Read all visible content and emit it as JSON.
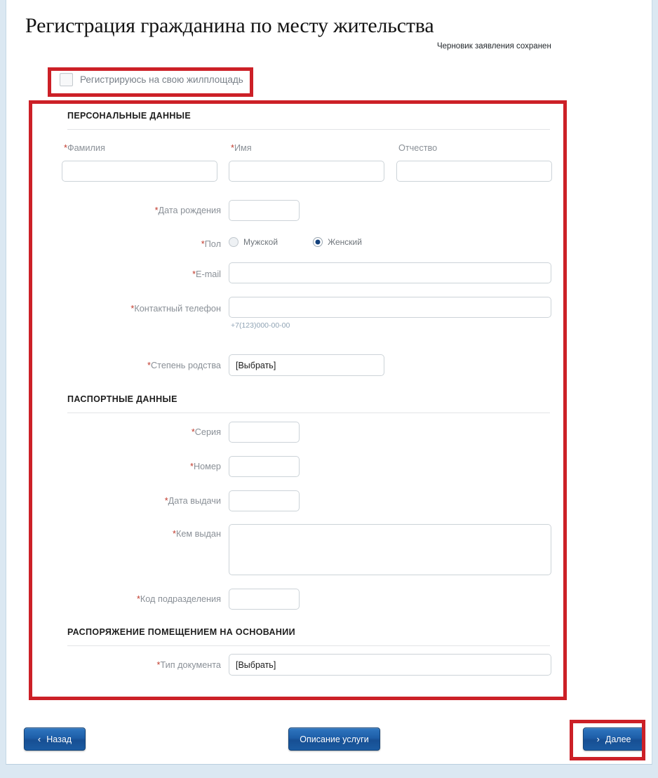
{
  "header": {
    "title": "Регистрация гражданина по месту жительства",
    "draft_note": "Черновик заявления сохранен"
  },
  "self_registration": {
    "label": "Регистрируюсь на свою жилплощадь",
    "checked": false
  },
  "sections": {
    "personal": {
      "title": "ПЕРСОНАЛЬНЫЕ ДАННЫЕ",
      "fields": {
        "surname": {
          "label": "Фамилия",
          "required": true,
          "value": ""
        },
        "firstname": {
          "label": "Имя",
          "required": true,
          "value": ""
        },
        "patronymic": {
          "label": "Отчество",
          "required": false,
          "value": ""
        },
        "birthdate": {
          "label": "Дата рождения",
          "required": true,
          "value": ""
        },
        "gender": {
          "label": "Пол",
          "required": true,
          "options": [
            "Мужской",
            "Женский"
          ],
          "selected": "Женский"
        },
        "email": {
          "label": "E-mail",
          "required": true,
          "value": ""
        },
        "phone": {
          "label": "Контактный телефон",
          "required": true,
          "value": "",
          "hint": "+7(123)000-00-00"
        },
        "relation": {
          "label": "Степень родства",
          "required": true,
          "value": "[Выбрать]"
        }
      }
    },
    "passport": {
      "title": "ПАСПОРТНЫЕ ДАННЫЕ",
      "fields": {
        "series": {
          "label": "Серия",
          "required": true,
          "value": ""
        },
        "number": {
          "label": "Номер",
          "required": true,
          "value": ""
        },
        "issue_date": {
          "label": "Дата выдачи",
          "required": true,
          "value": ""
        },
        "issued_by": {
          "label": "Кем выдан",
          "required": true,
          "value": ""
        },
        "division_code": {
          "label": "Код подразделения",
          "required": true,
          "value": ""
        }
      }
    },
    "premises": {
      "title": "РАСПОРЯЖЕНИЕ ПОМЕЩЕНИЕМ НА ОСНОВАНИИ",
      "fields": {
        "document_type": {
          "label": "Тип документа",
          "required": true,
          "value": "[Выбрать]"
        }
      }
    }
  },
  "footer": {
    "back": {
      "label": "Назад",
      "chevron": "‹"
    },
    "description": {
      "label": "Описание услуги"
    },
    "next": {
      "label": "Далее",
      "chevron": "›"
    }
  },
  "annotations": {
    "color": "#cc2027",
    "targets": [
      "self-registration-checkbox",
      "form-panel",
      "next-button"
    ]
  },
  "colors": {
    "page_background": "#dbe8f2",
    "sheet_background": "#ffffff",
    "button_blue": "#1d5ea8",
    "required_marker": "#c0392b",
    "label_gray": "#8a9097",
    "annotation_red": "#cc2027"
  }
}
